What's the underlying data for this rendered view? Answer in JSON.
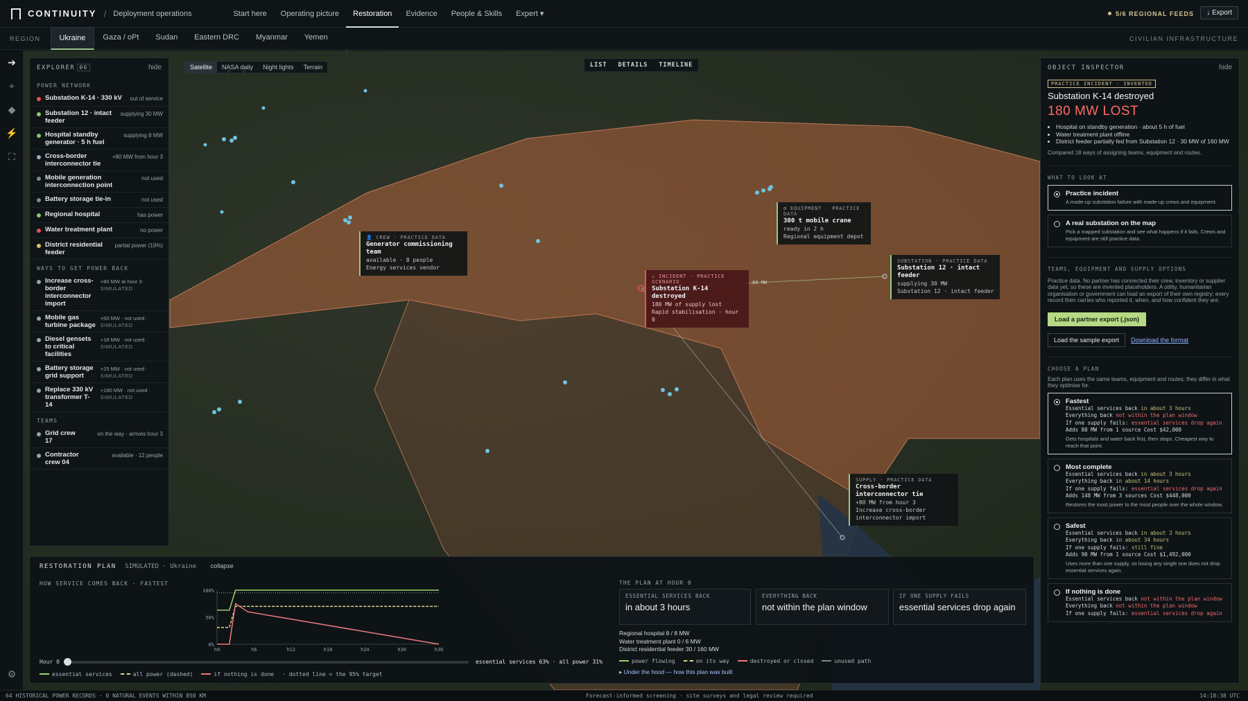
{
  "app": {
    "brand": "CONTINUITY",
    "context": "Deployment operations"
  },
  "nav": [
    "Start here",
    "Operating picture",
    "Restoration",
    "Evidence",
    "People & Skills",
    "Expert ▾"
  ],
  "nav_active": "Restoration",
  "feeds": "5/6 REGIONAL FEEDS",
  "export_label": "↓ Export",
  "region": {
    "label": "REGION",
    "tabs": [
      "Ukraine",
      "Gaza / oPt",
      "Sudan",
      "Eastern DRC",
      "Myanmar",
      "Yemen"
    ],
    "right": "CIVILIAN INFRASTRUCTURE"
  },
  "explorer": {
    "title": "EXPLORER",
    "count": "06",
    "hide": "hide",
    "power_heading": "POWER NETWORK",
    "power": [
      {
        "name": "Substation K-14 · 330 kV",
        "status": "out of service",
        "color": "#e5534b"
      },
      {
        "name": "Substation 12 · intact feeder",
        "status": "supplying 30 MW",
        "color": "#8cc86a"
      },
      {
        "name": "Hospital standby generator · 5 h fuel",
        "status": "supplying 8 MW",
        "color": "#8cc86a"
      },
      {
        "name": "Cross-border interconnector tie",
        "status": "+80 MW from hour 3",
        "color": "#9ab0c0"
      },
      {
        "name": "Mobile generation interconnection point",
        "status": "not used",
        "color": "#7f8a90"
      },
      {
        "name": "Battery storage tie-in",
        "status": "not used",
        "color": "#7f8a90"
      },
      {
        "name": "Regional hospital",
        "status": "has power",
        "color": "#8cc86a"
      },
      {
        "name": "Water treatment plant",
        "status": "no power",
        "color": "#e5534b"
      },
      {
        "name": "District residential feeder",
        "status": "partial power (19%)",
        "color": "#e0c05a"
      }
    ],
    "ways_heading": "WAYS TO GET POWER BACK",
    "ways": [
      {
        "name": "Increase cross-border interconnector import",
        "status": "+80 MW at hour 3 ·",
        "sim": "SIMULATED"
      },
      {
        "name": "Mobile gas turbine package",
        "status": "+50 MW · not used ·",
        "sim": "SIMULATED"
      },
      {
        "name": "Diesel gensets to critical facilities",
        "status": "+18 MW · not used ·",
        "sim": "SIMULATED"
      },
      {
        "name": "Battery storage grid support",
        "status": "+25 MW · not used ·",
        "sim": "SIMULATED"
      },
      {
        "name": "Replace 330 kV transformer T-14",
        "status": "+180 MW · not used ·",
        "sim": "SIMULATED"
      }
    ],
    "teams_heading": "TEAMS",
    "teams": [
      {
        "name": "Grid crew 17",
        "status": "on the way · arrives hour 3"
      },
      {
        "name": "Contractor crew 04",
        "status": "available · 12 people"
      }
    ]
  },
  "layers": [
    "Satellite",
    "NASA daily",
    "Night lights",
    "Terrain"
  ],
  "views": [
    "LIST",
    "DETAILS",
    "TIMELINE"
  ],
  "callouts": {
    "crew": {
      "kicker": "👤 CREW · PRACTICE DATA",
      "title": "Generator commissioning team",
      "lines": [
        "available · 8 people",
        "Energy services vendor"
      ]
    },
    "crane": {
      "kicker": "⚙ EQUIPMENT · PRACTICE DATA",
      "title": "300 t mobile crane",
      "lines": [
        "ready in 2 h",
        "Regional equipment depot"
      ]
    },
    "incident": {
      "kicker": "⚠ INCIDENT · PRACTICE SCENARIO",
      "title": "Substation K-14 destroyed",
      "lines": [
        "180 MW of supply lost",
        "Rapid stabilisation · hour 0"
      ]
    },
    "substation": {
      "kicker": "SUBSTATION · PRACTICE DATA",
      "title": "Substation 12 · intact feeder",
      "lines": [
        "supplying 30 MW",
        "Substation 12 · intact feeder"
      ]
    },
    "supply": {
      "kicker": "SUPPLY · PRACTICE DATA",
      "title": "Cross-border interconnector tie",
      "lines": [
        "+80 MW from hour 3",
        "Increase cross-border interconnector import"
      ]
    }
  },
  "map_label": "80 MW",
  "inspector": {
    "title": "OBJECT INSPECTOR",
    "hide": "hide",
    "badge": "PRACTICE INCIDENT · INVENTED",
    "name": "Substation K-14 destroyed",
    "loss": "180 MW LOST",
    "bullets": [
      "Hospital on standby generation · about 5 h of fuel",
      "Water treatment plant offline",
      "District feeder partially fed from Substation 12 · 30 MW of 160 MW"
    ],
    "note": "Compared 18 ways of assigning teams, equipment and routes.",
    "look_heading": "WHAT TO LOOK AT",
    "look": [
      {
        "title": "Practice incident",
        "sub": "A made-up substation failure with made-up crews and equipment."
      },
      {
        "title": "A real substation on the map",
        "sub": "Pick a mapped substation and see what happens if it fails. Crews and equipment are still practice data."
      }
    ],
    "teams_heading": "TEAMS, EQUIPMENT AND SUPPLY OPTIONS",
    "teams_text": "Practice data. No partner has connected their crew, inventory or supplier data yet, so these are invented placeholders. A utility, humanitarian organisation or government can load an export of their own registry; every record then carries who reported it, when, and how confident they are.",
    "load_btn": "Load a partner export (.json)",
    "sample_btn": "Load the sample export",
    "format_link": "Download the format",
    "plan_heading": "CHOOSE A PLAN",
    "plan_text": "Each plan uses the same teams, equipment and routes; they differ in what they optimise for.",
    "l_ess": "Essential services back",
    "l_all": "Everything back",
    "l_fail": "If one supply fails:",
    "plans": [
      {
        "name": "Fastest",
        "ess": "in about 3 hours",
        "all": "not within the plan window",
        "fail": "essential services drop again",
        "adds": "Adds 80 MW from 1 source",
        "cost": "Cost $42,000",
        "desc": "Gets hospitals and water back first, then stops. Cheapest way to reach that point."
      },
      {
        "name": "Most complete",
        "ess": "in about 3 hours",
        "all": "in about 14 hours",
        "fail": "essential services drop again",
        "adds": "Adds 148 MW from 3 sources",
        "cost": "Cost $448,000",
        "desc": "Restores the most power to the most people over the whole window."
      },
      {
        "name": "Safest",
        "ess": "in about 3 hours",
        "all": "in about 34 hours",
        "fail": "still fine",
        "adds": "Adds 90 MW from 1 source",
        "cost": "Cost $1,492,000",
        "desc": "Uses more than one supply, so losing any single one does not drop essential services again."
      },
      {
        "name": "If nothing is done",
        "ess": "not within the plan window",
        "all": "not within the plan window",
        "fail": "essential services drop again",
        "adds": "",
        "cost": "",
        "desc": ""
      }
    ]
  },
  "plan_panel": {
    "title": "RESTORATION PLAN",
    "sub": "SIMULATED · Ukraine",
    "collapse": "collapse",
    "chart_title": "HOW SERVICE COMES BACK · FASTEST",
    "hour_label": "Hour 0",
    "readout": "essential services 63% · all power 31%",
    "legend": [
      "essential services",
      "all power (dashed)",
      "if nothing is done",
      "· dotted line = the 95% target"
    ],
    "at_hour": "THE PLAN AT HOUR 0",
    "cards": [
      {
        "label": "ESSENTIAL SERVICES BACK",
        "value": "in about 3 hours"
      },
      {
        "label": "EVERYTHING BACK",
        "value": "not within the plan window"
      },
      {
        "label": "IF ONE SUPPLY FAILS",
        "value": "essential services drop again"
      }
    ],
    "facts": [
      "Regional hospital 8 / 8 MW",
      "Water treatment plant 0 / 6 MW",
      "District residential feeder 30 / 160 MW"
    ],
    "flow_legend": [
      "power flowing",
      "on its way",
      "destroyed or closed",
      "unused path"
    ],
    "under_hood": "▸ Under the hood — how this plan was built"
  },
  "chart_data": {
    "type": "line",
    "title": "HOW SERVICE COMES BACK · FASTEST",
    "x_ticks": [
      "h0",
      "h6",
      "h12",
      "h18",
      "h24",
      "h30",
      "h36"
    ],
    "y_ticks": [
      "100%",
      "50%",
      "0%"
    ],
    "ylim": [
      0,
      100
    ],
    "xlim": [
      0,
      36
    ],
    "series": [
      {
        "name": "essential services",
        "x": [
          0,
          2,
          3,
          36
        ],
        "y": [
          63,
          63,
          100,
          100
        ],
        "color": "#9bd46a"
      },
      {
        "name": "all power (dashed)",
        "x": [
          0,
          2,
          3,
          4,
          36
        ],
        "y": [
          31,
          31,
          70,
          70,
          70
        ],
        "color": "#e0d58a"
      },
      {
        "name": "if nothing is done",
        "x": [
          0,
          2,
          3,
          5,
          36
        ],
        "y": [
          0,
          0,
          75,
          60,
          0
        ],
        "color": "#f07a7a"
      }
    ],
    "target": 95
  },
  "status": {
    "left": "64 HISTORICAL POWER RECORDS · 0 NATURAL EVENTS WITHIN 850 KM",
    "center": "Forecast-informed screening · site surveys and legal review required",
    "right": "14:18:38 UTC"
  }
}
